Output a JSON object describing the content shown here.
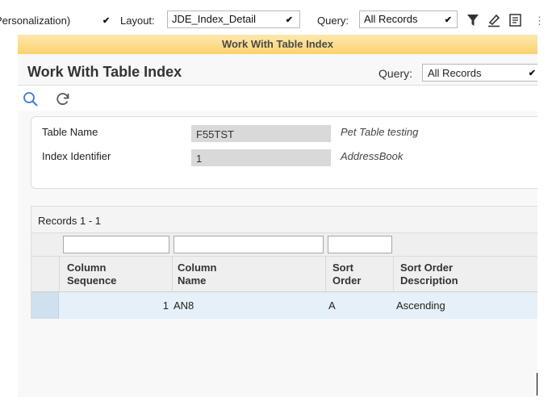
{
  "toolbar": {
    "personalization": "Personalization)",
    "layout_label": "Layout:",
    "layout_value": "JDE_Index_Detail",
    "query_label": "Query:",
    "query_value": "All Records",
    "icons": [
      "filter-icon",
      "edit-icon",
      "notes-icon"
    ]
  },
  "title_bar": "Work With Table Index",
  "form": {
    "title": "Work With Table Index",
    "query_label": "Query:",
    "query_value": "All Records",
    "icons": [
      "search-icon",
      "refresh-icon"
    ]
  },
  "header": {
    "table_name_label": "Table Name",
    "table_name_value": "F55TST",
    "table_name_desc": "Pet Table testing",
    "index_label": "Index Identifier",
    "index_value": "1",
    "index_desc": "AddressBook"
  },
  "grid": {
    "records_label": "Records 1 - 1",
    "columns": [
      {
        "line1": "Column",
        "line2": "Sequence"
      },
      {
        "line1": "Column",
        "line2": "Name"
      },
      {
        "line1": "Sort",
        "line2": "Order"
      },
      {
        "line1": "Sort Order",
        "line2": "Description"
      }
    ],
    "rows": [
      {
        "sequence": "1",
        "name": "AN8",
        "sort_order": "A",
        "description": "Ascending"
      }
    ]
  },
  "colors": {
    "title_bar_top": "#fde8b0",
    "title_bar_bottom": "#fbd26e",
    "selected_row": "#e6f0f8",
    "icon_blue": "#3a7bd5"
  }
}
